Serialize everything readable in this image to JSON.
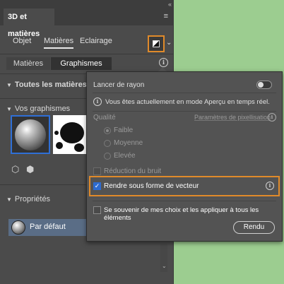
{
  "window": {
    "collapse_glyph": "«",
    "tab_title": "3D et matières",
    "close_glyph": "≡"
  },
  "subtabs": {
    "objet": "Objet",
    "matieres": "Matières",
    "eclairage": "Eclairage"
  },
  "segmented": {
    "matieres": "Matières",
    "graphismes": "Graphismes"
  },
  "sections": {
    "all_materials": "Toutes les matières et",
    "your_graphics": "Vos graphismes",
    "properties": "Propriétés"
  },
  "properties": {
    "default_label": "Par défaut"
  },
  "popup": {
    "raytrace_label": "Lancer de rayon",
    "raytrace_on": false,
    "preview_notice": "Vous êtes actuellement en mode Aperçu en temps réel.",
    "quality_label": "Qualité",
    "pixelisation_link": "Paramètres de pixellisation",
    "quality_options": [
      "Faible",
      "Moyenne",
      "Elevée"
    ],
    "quality_selected": "Faible",
    "noise_reduction": "Réduction du bruit",
    "noise_reduction_checked": false,
    "vector_render": "Rendre sous forme de vecteur",
    "vector_render_checked": true,
    "remember_choices": "Se souvenir de mes choix et les appliquer à tous les éléments",
    "remember_checked": false,
    "render_button": "Rendu"
  },
  "colors": {
    "accent_orange": "#e08a2a",
    "selection_blue": "#2f6fd6",
    "panel_bg": "#4b4b4b",
    "page_bg": "#9ccd90"
  }
}
